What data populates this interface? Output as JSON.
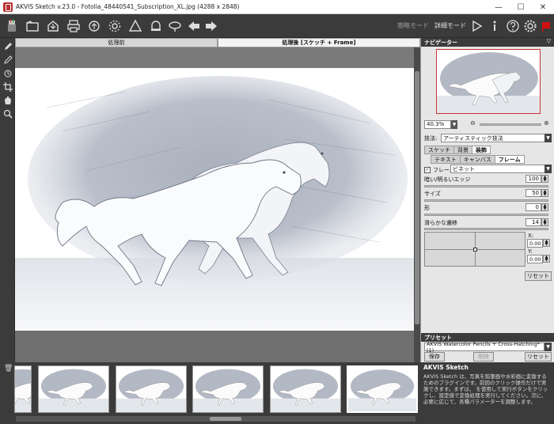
{
  "window": {
    "title": "AKVIS Sketch v.23.0 - Fotolia_48440541_Subscription_XL.jpg (4288 x 2848)",
    "minimize": "—",
    "maximize": "☐",
    "close": "✕"
  },
  "toolbar": {
    "express_mode": "簡略モード",
    "advanced_mode": "詳細モード"
  },
  "canvas": {
    "tab_before": "処理前",
    "tab_after": "処理後 [スケッチ + Frame]"
  },
  "navigator": {
    "title": "ナビゲーター",
    "zoom_value": "40.3%"
  },
  "settings": {
    "technique_label": "技法:",
    "technique_value": "アーティスティック技法",
    "tabs": [
      "スケッチ",
      "背景",
      "装飾"
    ],
    "subtabs": [
      "テキスト",
      "キャンバス",
      "フレーム"
    ],
    "frame_checkbox_label": "フレーム",
    "frame_type": "ビネット",
    "dark_edge_label": "暗い/明るいエッジ",
    "dark_edge_value": "100",
    "size_label": "サイズ",
    "size_value": "50",
    "shape_label": "形",
    "shape_value": "0",
    "smooth_label": "滑らかな遷移",
    "smooth_value": "14",
    "x_label": "X:",
    "x_value": "0.00",
    "y_label": "Y:",
    "y_value": "0.00",
    "reset_label": "リセット"
  },
  "presets": {
    "title": "プリセット",
    "value": "AKVIS Watercolor Pencils + Cross-Hatching* (1)",
    "save": "保存",
    "delete": "削除",
    "reset": "リセット"
  },
  "info": {
    "title": "AKVIS Sketch",
    "body": "AKVIS Sketch は、写真を鉛筆画や水彩画に変換するためのプラグインです。前回のクリック操作だけで実施できます。まずは、 を使用して実行ボタンをクリックし、設定値で変換処理を実行してください。次に、必要に応じて、各種パラメーターを調整します。"
  },
  "colors": {
    "panel_dark": "#3b3b3b",
    "panel_light": "#e6e6e6",
    "accent_red": "#d11111"
  }
}
